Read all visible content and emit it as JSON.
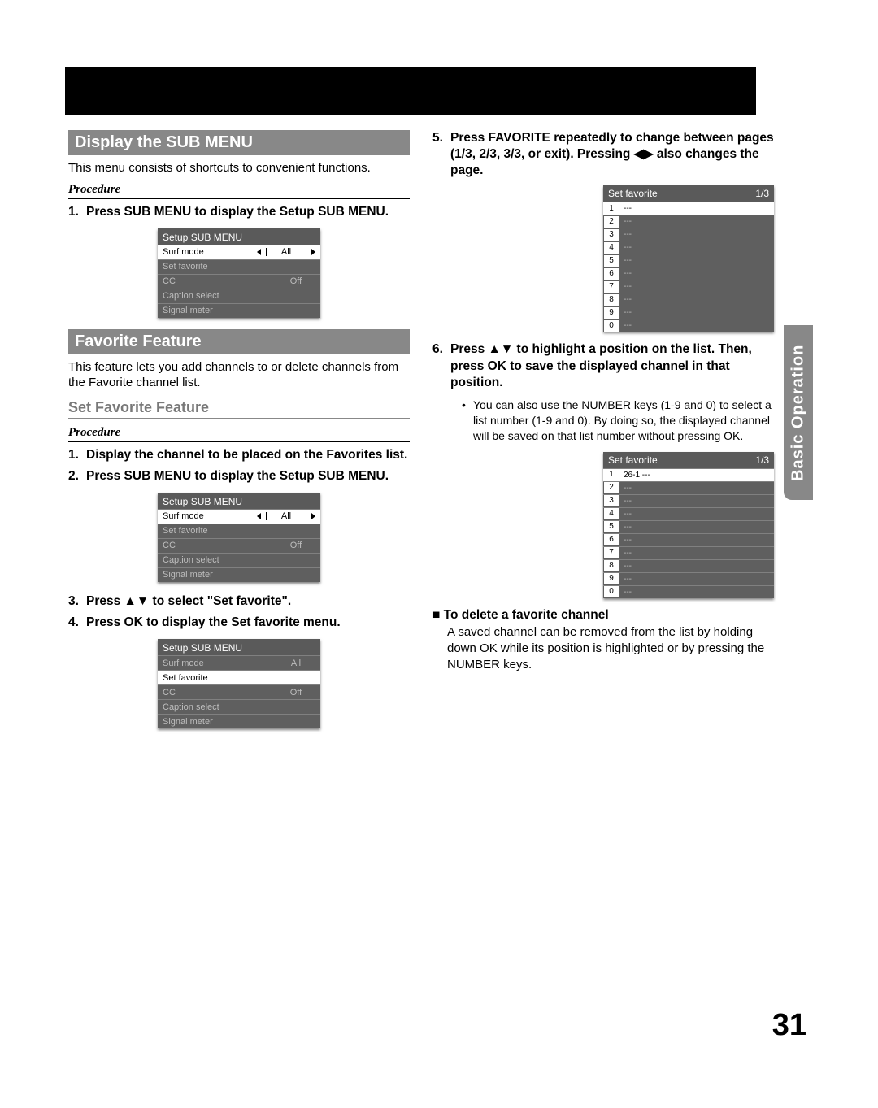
{
  "page_number": "31",
  "side_tab": "Basic Operation",
  "left": {
    "h1": "Display the SUB MENU",
    "intro": "This menu consists of shortcuts to convenient functions.",
    "procedure_label": "Procedure",
    "step1": "Press SUB MENU to display the Setup SUB MENU.",
    "menu1": {
      "title": "Setup SUB MENU",
      "rows": [
        {
          "label": "Surf mode",
          "val": "All",
          "active": true,
          "arrows": true
        },
        {
          "label": "Set favorite",
          "val": "",
          "dim": true
        },
        {
          "label": "CC",
          "val": "Off",
          "dim": true
        },
        {
          "label": "Caption select",
          "val": "",
          "dim": true
        },
        {
          "label": "Signal meter",
          "val": "",
          "dim": true
        }
      ]
    },
    "h2": "Favorite Feature",
    "intro2": "This feature lets you add channels to or delete channels from the Favorite channel list.",
    "sub": "Set Favorite Feature",
    "procedure_label2": "Procedure",
    "step_a": "Display the channel to be placed on the Favorites list.",
    "step_b": "Press SUB MENU to display the Setup SUB MENU.",
    "menu2": {
      "title": "Setup SUB MENU",
      "rows": [
        {
          "label": "Surf mode",
          "val": "All",
          "active": true,
          "arrows": true
        },
        {
          "label": "Set favorite",
          "val": "",
          "dim": true
        },
        {
          "label": "CC",
          "val": "Off",
          "dim": true
        },
        {
          "label": "Caption select",
          "val": "",
          "dim": true
        },
        {
          "label": "Signal meter",
          "val": "",
          "dim": true
        }
      ]
    },
    "step_c": "Press ▲▼ to select \"Set favorite\".",
    "step_d": "Press OK to display the Set favorite menu.",
    "menu3": {
      "title": "Setup SUB MENU",
      "rows": [
        {
          "label": "Surf mode",
          "val": "All",
          "dim": true
        },
        {
          "label": "Set favorite",
          "val": "",
          "active": true
        },
        {
          "label": "CC",
          "val": "Off",
          "dim": true
        },
        {
          "label": "Caption select",
          "val": "",
          "dim": true
        },
        {
          "label": "Signal meter",
          "val": "",
          "dim": true
        }
      ]
    }
  },
  "right": {
    "step5": "Press FAVORITE repeatedly to change between pages (1/3, 2/3, 3/3, or exit). Pressing ◀▶ also changes the page.",
    "fav1": {
      "title": "Set favorite",
      "page": "1/3",
      "rows": [
        {
          "n": "1",
          "ch": "---",
          "active": true
        },
        {
          "n": "2",
          "ch": "---"
        },
        {
          "n": "3",
          "ch": "---"
        },
        {
          "n": "4",
          "ch": "---"
        },
        {
          "n": "5",
          "ch": "---"
        },
        {
          "n": "6",
          "ch": "---"
        },
        {
          "n": "7",
          "ch": "---"
        },
        {
          "n": "8",
          "ch": "---"
        },
        {
          "n": "9",
          "ch": "---"
        },
        {
          "n": "0",
          "ch": "---"
        }
      ]
    },
    "step6": "Press ▲▼ to highlight a position on the list. Then, press OK to save the displayed channel in that position.",
    "note": "You can also use the NUMBER keys (1-9 and 0) to select a list number (1-9 and 0). By doing so, the displayed channel will be saved on that list number without pressing OK.",
    "fav2": {
      "title": "Set favorite",
      "page": "1/3",
      "rows": [
        {
          "n": "1",
          "ch": "26-1    ---",
          "active": true
        },
        {
          "n": "2",
          "ch": "---"
        },
        {
          "n": "3",
          "ch": "---"
        },
        {
          "n": "4",
          "ch": "---"
        },
        {
          "n": "5",
          "ch": "---"
        },
        {
          "n": "6",
          "ch": "---"
        },
        {
          "n": "7",
          "ch": "---"
        },
        {
          "n": "8",
          "ch": "---"
        },
        {
          "n": "9",
          "ch": "---"
        },
        {
          "n": "0",
          "ch": "---"
        }
      ]
    },
    "del_head": "To delete a favorite channel",
    "del_body": "A saved channel can be removed from the list by holding down OK while its position is highlighted or by pressing the NUMBER keys."
  }
}
